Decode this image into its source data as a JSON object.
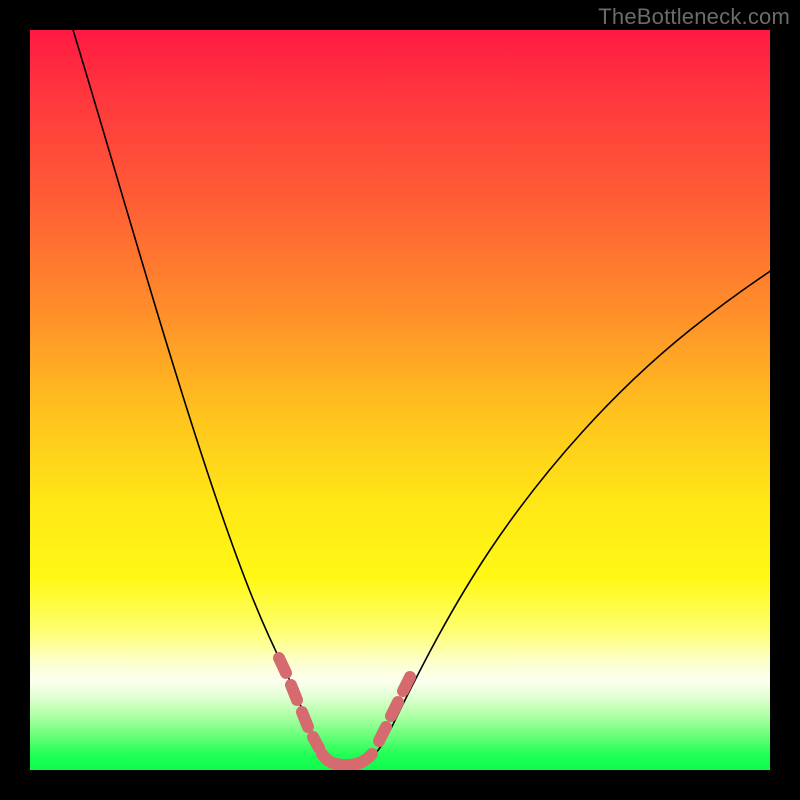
{
  "watermark": "TheBottleneck.com",
  "chart_data": {
    "type": "line",
    "title": "",
    "xlabel": "",
    "ylabel": "",
    "xlim": [
      0,
      100
    ],
    "ylim": [
      0,
      100
    ],
    "grid": false,
    "series": [
      {
        "name": "bottleneck-curve",
        "x": [
          5,
          10,
          15,
          20,
          25,
          27,
          30,
          33,
          35,
          37,
          40,
          43,
          45,
          50,
          55,
          60,
          65,
          70,
          75,
          80,
          85,
          90,
          95,
          100
        ],
        "values": [
          100,
          82,
          64,
          47,
          31,
          25,
          16,
          9,
          5,
          2,
          1,
          1,
          2,
          7,
          14,
          21,
          28,
          35,
          41,
          47,
          52,
          57,
          62,
          66
        ]
      }
    ],
    "minimum_region": {
      "x_start": 36,
      "x_end": 44,
      "y": 1
    },
    "highlight_segments": [
      {
        "side": "left",
        "x_start": 32,
        "x_end": 37
      },
      {
        "side": "right",
        "x_start": 44,
        "x_end": 49
      }
    ],
    "colors": {
      "curve": "#000000",
      "highlight": "#d56b6f",
      "background_top": "#ff1a43",
      "background_bottom": "#0dfc4c"
    }
  }
}
